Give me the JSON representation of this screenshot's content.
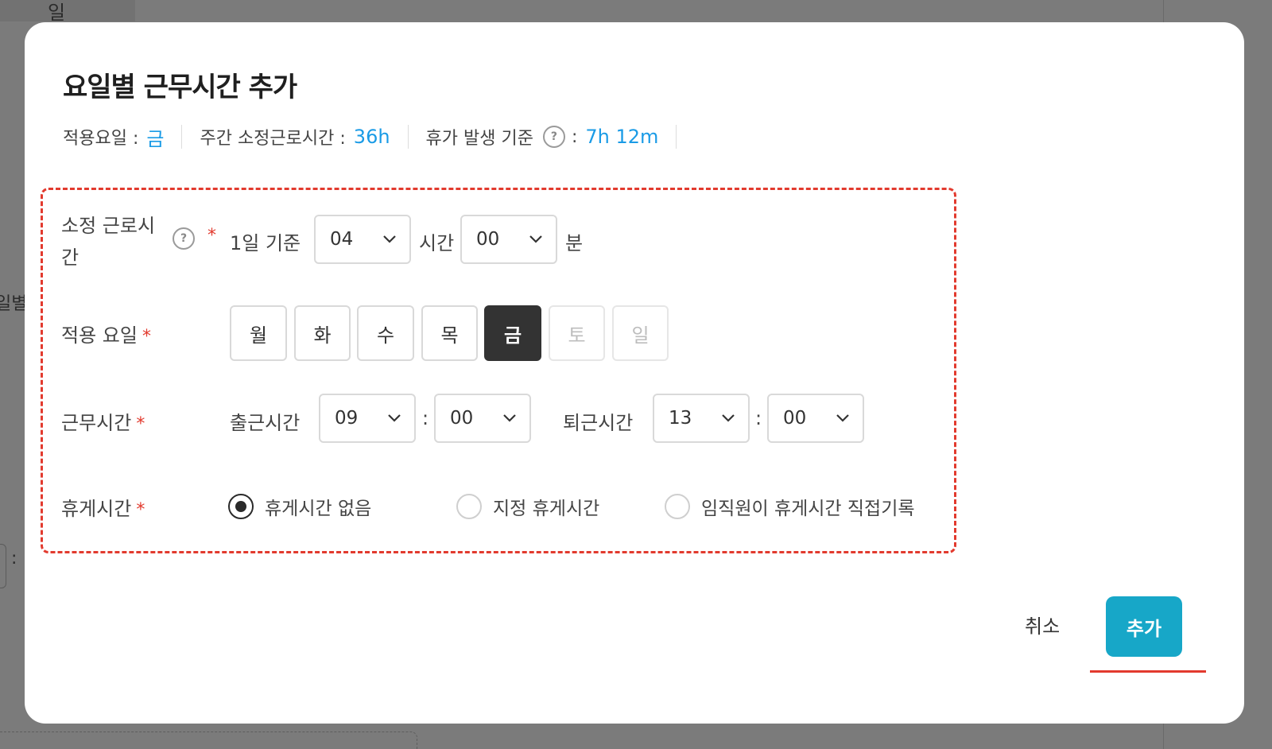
{
  "background": {
    "tab_label": "일",
    "left_label": "일별",
    "left_colon": ":"
  },
  "modal": {
    "title": "요일별 근무시간 추가",
    "summary": {
      "applied_days_label": "적용요일 :",
      "applied_days_value": "금",
      "weekly_hours_label": "주간 소정근로시간 :",
      "weekly_hours_value": "36h",
      "leave_basis_label": "휴가 발생 기준",
      "leave_basis_colon": ":",
      "leave_basis_value": "7h 12m"
    },
    "help_icon": "?",
    "form": {
      "contract_hours": {
        "label_line1": "소정 근로시",
        "label_line2": "간",
        "required_mark": "*",
        "basis_text": "1일 기준",
        "hours_value": "04",
        "hours_unit": "시간",
        "minutes_value": "00",
        "minutes_unit": "분"
      },
      "applied_days": {
        "label": "적용 요일",
        "required_mark": "*",
        "days": [
          {
            "label": "월",
            "state": "normal"
          },
          {
            "label": "화",
            "state": "normal"
          },
          {
            "label": "수",
            "state": "normal"
          },
          {
            "label": "목",
            "state": "normal"
          },
          {
            "label": "금",
            "state": "selected"
          },
          {
            "label": "토",
            "state": "disabled"
          },
          {
            "label": "일",
            "state": "disabled"
          }
        ]
      },
      "work_hours": {
        "label": "근무시간",
        "required_mark": "*",
        "start_label": "출근시간",
        "start_hour": "09",
        "start_minute": "00",
        "end_label": "퇴근시간",
        "end_hour": "13",
        "end_minute": "00",
        "separator": ":"
      },
      "break_time": {
        "label": "휴게시간",
        "required_mark": "*",
        "options": [
          {
            "label": "휴게시간 없음",
            "checked": true
          },
          {
            "label": "지정 휴게시간",
            "checked": false
          },
          {
            "label": "임직원이 휴게시간 직접기록",
            "checked": false
          }
        ]
      }
    },
    "buttons": {
      "cancel": "취소",
      "add": "추가"
    },
    "colors": {
      "accent": "#17a7c8",
      "value_blue": "#1a9be6",
      "annotation_red": "#e23a2e",
      "selected_day": "#333333"
    }
  }
}
